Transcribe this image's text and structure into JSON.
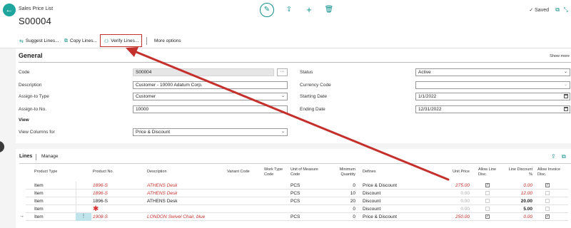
{
  "header": {
    "page_caption": "Sales Price List",
    "record_title": "S00004",
    "saved_label": "Saved"
  },
  "actions": {
    "suggest": "Suggest Lines...",
    "copy": "Copy Lines...",
    "verify": "Verify Lines...",
    "more": "More options"
  },
  "general": {
    "title": "General",
    "show_more": "Show more",
    "code_label": "Code",
    "code_value": "S00004",
    "description_label": "Description",
    "description_value": "Customer - 10000 Adatum Corp.",
    "assign_type_label": "Assign-to Type",
    "assign_type_value": "Customer",
    "assign_no_label": "Assign-to No.",
    "assign_no_value": "10000",
    "view_heading": "View",
    "view_columns_label": "View Columns for",
    "view_columns_value": "Price & Discount",
    "status_label": "Status",
    "status_value": "Active",
    "currency_label": "Currency Code",
    "currency_value": "",
    "start_label": "Starting Date",
    "start_value": "1/1/2022",
    "end_label": "Ending Date",
    "end_value": "12/31/2022"
  },
  "lines": {
    "title": "Lines",
    "manage": "Manage",
    "columns": {
      "product_type": "Product Type",
      "product_no": "Product No.",
      "description": "Description",
      "variant_code": "Variant Code",
      "work_type_1": "Work Type",
      "work_type_2": "Code",
      "uom_1": "Unit of Measure",
      "uom_2": "Code",
      "min_qty_1": "Minimum",
      "min_qty_2": "Quantity",
      "defines": "Defines",
      "unit_price": "Unit Price",
      "allow_line_1": "Allow Line",
      "allow_line_2": "Disc.",
      "line_disc_1": "Line Discount",
      "line_disc_2": "%",
      "allow_inv_1": "Allow Invoice",
      "allow_inv_2": "Disc."
    },
    "rows": [
      {
        "type": "Item",
        "no": "1896-S",
        "desc": "ATHENS Desk",
        "uom": "PCS",
        "min": "0",
        "defines": "Price & Discount",
        "price": "275.00",
        "disc": "0.00"
      },
      {
        "type": "Item",
        "no": "1896-S",
        "desc": "ATHENS Desk",
        "uom": "PCS",
        "min": "10",
        "defines": "Discount",
        "price": "0.00",
        "disc": "12.00"
      },
      {
        "type": "Item",
        "no": "1896-S",
        "desc": "ATHENS Desk",
        "uom": "PCS",
        "min": "20",
        "defines": "Discount",
        "price": "0.00",
        "disc": "20.00"
      },
      {
        "type": "Item",
        "no": "",
        "desc": "",
        "uom": "",
        "min": "0",
        "defines": "Discount",
        "price": "0.00",
        "disc": "5.00"
      },
      {
        "type": "Item",
        "no": "1908-S",
        "desc": "LONDON Swivel Chair, blue",
        "uom": "PCS",
        "min": "0",
        "defines": "Price & Discount",
        "price": "250.00",
        "disc": "0.00"
      }
    ]
  },
  "colors": {
    "accent": "#0d8f89",
    "highlight": "#c4312d"
  }
}
